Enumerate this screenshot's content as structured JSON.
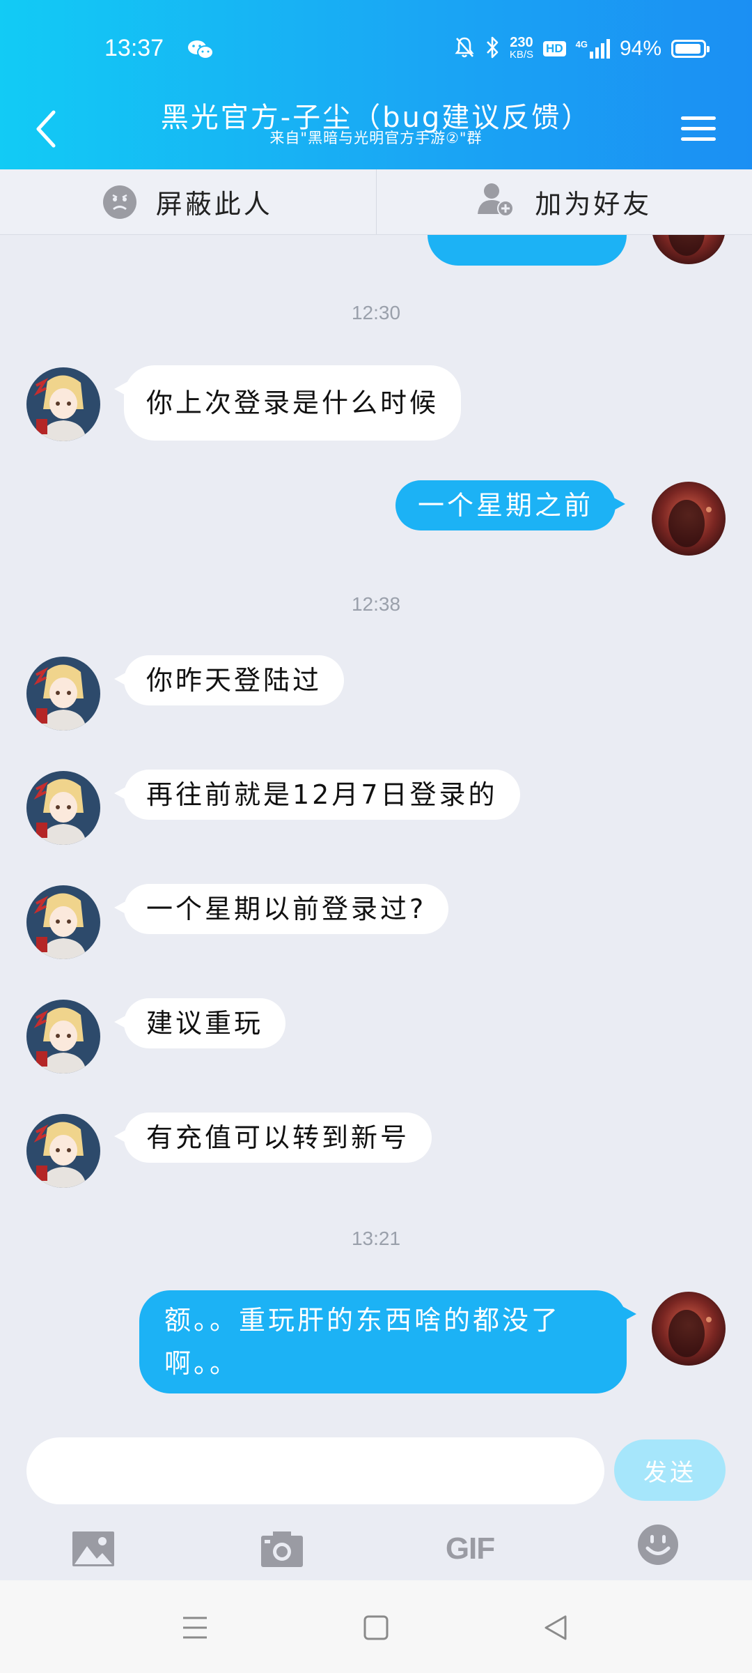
{
  "status_bar": {
    "time": "13:37",
    "network_speed_value": "230",
    "network_speed_unit": "KB/S",
    "hd_badge": "HD",
    "network_type": "4G",
    "battery_percent": "94%",
    "battery_level": 0.94
  },
  "header": {
    "title": "黑光官方-子尘（bug建议反馈）",
    "subtitle": "来自\"黑暗与光明官方手游②\"群"
  },
  "actions": {
    "block_label": "屏蔽此人",
    "add_friend_label": "加为好友"
  },
  "chat": {
    "timestamps": [
      "12:30",
      "12:38",
      "13:21"
    ],
    "messages": [
      {
        "sender": "other",
        "text": "你上次登录是什么时候"
      },
      {
        "sender": "me",
        "text": "一个星期之前"
      },
      {
        "sender": "other",
        "text": "你昨天登陆过"
      },
      {
        "sender": "other",
        "text": "再往前就是12月7日登录的"
      },
      {
        "sender": "other",
        "text": "一个星期以前登录过?"
      },
      {
        "sender": "other",
        "text": "建议重玩"
      },
      {
        "sender": "other",
        "text": "有充值可以转到新号"
      },
      {
        "sender": "me",
        "text_line1": "额。。重玩肝的东西啥的都没了",
        "text_line2": "啊。。"
      }
    ]
  },
  "input": {
    "value": "",
    "send_label": "发送"
  },
  "toolbar": {
    "gif_label": "GIF"
  },
  "colors": {
    "header_gradient_start": "#12cbf5",
    "header_gradient_end": "#1b8ff3",
    "outgoing_bubble": "#1cb2f5",
    "incoming_bubble": "#ffffff",
    "chat_background": "#eaecf3",
    "send_button": "#a6e6fb"
  },
  "icons": [
    "wechat-icon",
    "mute-icon",
    "bluetooth-icon",
    "signal-icon",
    "battery-icon",
    "back-icon",
    "menu-icon",
    "block-icon",
    "add-friend-icon",
    "image-icon",
    "camera-icon",
    "gif-icon",
    "emoji-icon",
    "nav-menu-icon",
    "nav-home-icon",
    "nav-back-icon"
  ]
}
